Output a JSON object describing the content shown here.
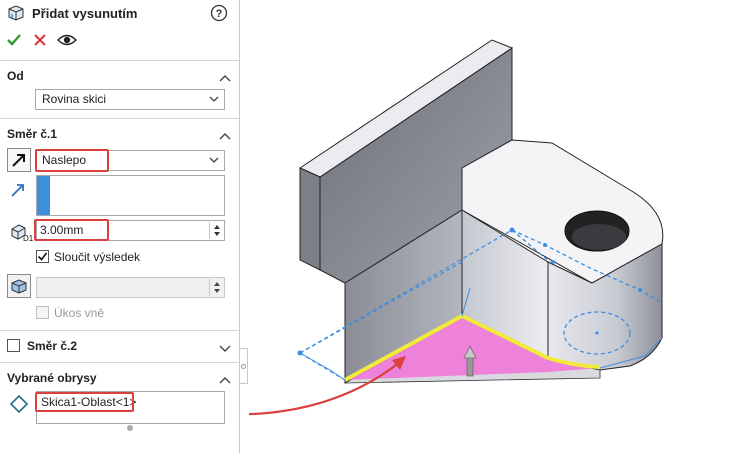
{
  "header": {
    "title": "Přidat vysunutím",
    "help_icon": "help-icon",
    "confirm_icon": "checkmark-icon",
    "cancel_icon": "cancel-x-icon",
    "preview_icon": "eye-icon"
  },
  "from_section": {
    "title": "Od",
    "selected": "Rovina skici"
  },
  "direction1": {
    "title": "Směr č.1",
    "end_condition": "Naslepo",
    "depth": "3.00mm",
    "merge_label": "Sloučit výsledek",
    "merge_checked": true,
    "draft_outward_label": "Úkos vně",
    "draft_outward_checked": false
  },
  "direction2": {
    "title": "Směr č.2",
    "checked": false
  },
  "contours": {
    "title": "Vybrané obrysy",
    "item": "Skica1-Oblast<1>"
  },
  "colors": {
    "accent_red": "#d9413c",
    "check_green": "#2e9b2e",
    "selection_blue": "#3e8ede",
    "preview_pink": "#f07ad8",
    "highlight_yellow": "#f2ea3a"
  }
}
